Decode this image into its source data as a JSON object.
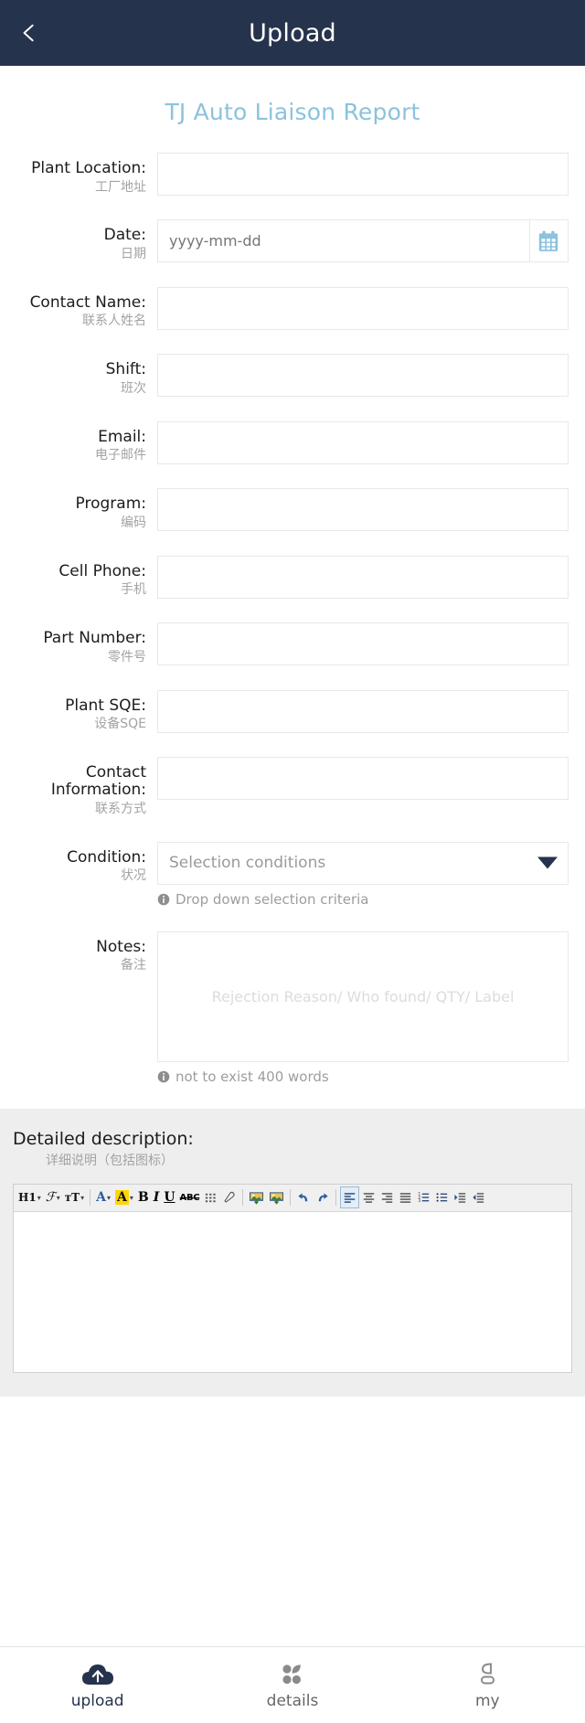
{
  "header": {
    "title": "Upload",
    "back_icon": "back-chevron-icon"
  },
  "report": {
    "title": "TJ Auto Liaison Report",
    "title_color": "#8cc2dd"
  },
  "form": {
    "fields": [
      {
        "label_en": "Plant Location:",
        "label_cn": "工厂地址",
        "type": "text",
        "value": "",
        "placeholder": ""
      },
      {
        "label_en": "Date:",
        "label_cn": "日期",
        "type": "date",
        "value": "",
        "placeholder": "yyyy-mm-dd",
        "icon": "calendar-icon"
      },
      {
        "label_en": "Contact Name:",
        "label_cn": "联系人姓名",
        "type": "text",
        "value": "",
        "placeholder": ""
      },
      {
        "label_en": "Shift:",
        "label_cn": "班次",
        "type": "text",
        "value": "",
        "placeholder": ""
      },
      {
        "label_en": "Email:",
        "label_cn": "电子邮件",
        "type": "text",
        "value": "",
        "placeholder": ""
      },
      {
        "label_en": "Program:",
        "label_cn": "编码",
        "type": "text",
        "value": "",
        "placeholder": ""
      },
      {
        "label_en": "Cell Phone:",
        "label_cn": "手机",
        "type": "text",
        "value": "",
        "placeholder": ""
      },
      {
        "label_en": "Part Number:",
        "label_cn": "零件号",
        "type": "text",
        "value": "",
        "placeholder": ""
      },
      {
        "label_en": "Plant SQE:",
        "label_cn": "设备SQE",
        "type": "text",
        "value": "",
        "placeholder": ""
      },
      {
        "label_en": "Contact Information:",
        "label_cn": "联系方式",
        "type": "text",
        "value": "",
        "placeholder": ""
      },
      {
        "label_en": "Condition:",
        "label_cn": "状况",
        "type": "select",
        "value": "",
        "placeholder": "Selection conditions",
        "hint": "Drop down selection criteria",
        "caret_color": "#26334d"
      },
      {
        "label_en": "Notes:",
        "label_cn": "备注",
        "type": "textarea",
        "value": "",
        "placeholder": "Rejection Reason/ Who found/ QTY/ Label",
        "hint": "not to exist 400 words"
      }
    ]
  },
  "description": {
    "heading_en": "Detailed description:",
    "heading_cn": "详细说明（包括图标）",
    "editor_value": "",
    "toolbar": [
      {
        "name": "heading-select",
        "label": "H1",
        "caret": true
      },
      {
        "name": "font-family-select",
        "label": "ℱ",
        "caret": true
      },
      {
        "name": "font-size-select",
        "label": "ᴛT",
        "caret": true
      },
      {
        "name": "separator-1",
        "label": ""
      },
      {
        "name": "text-color-button",
        "label": "A",
        "caret": true
      },
      {
        "name": "highlight-color-button",
        "label": "A",
        "caret": true
      },
      {
        "name": "bold-button",
        "label": "B"
      },
      {
        "name": "italic-button",
        "label": "I"
      },
      {
        "name": "underline-button",
        "label": "U"
      },
      {
        "name": "strikethrough-button",
        "label": "ABC"
      },
      {
        "name": "table-button",
        "label": ""
      },
      {
        "name": "clear-format-button",
        "label": ""
      },
      {
        "name": "separator-2",
        "label": ""
      },
      {
        "name": "insert-image-button",
        "label": ""
      },
      {
        "name": "upload-image-button",
        "label": ""
      },
      {
        "name": "separator-3",
        "label": ""
      },
      {
        "name": "undo-button",
        "label": ""
      },
      {
        "name": "redo-button",
        "label": ""
      },
      {
        "name": "separator-4",
        "label": ""
      },
      {
        "name": "align-left-button",
        "label": "",
        "active": true
      },
      {
        "name": "align-center-button",
        "label": ""
      },
      {
        "name": "align-right-button",
        "label": ""
      },
      {
        "name": "align-justify-button",
        "label": ""
      },
      {
        "name": "ordered-list-button",
        "label": ""
      },
      {
        "name": "unordered-list-button",
        "label": ""
      },
      {
        "name": "indent-button",
        "label": ""
      },
      {
        "name": "outdent-button",
        "label": ""
      }
    ]
  },
  "tabbar": {
    "items": [
      {
        "label": "upload",
        "icon": "cloud-upload-icon",
        "active": true
      },
      {
        "label": "details",
        "icon": "grid-icon",
        "active": false
      },
      {
        "label": "my",
        "icon": "person-icon",
        "active": false
      }
    ],
    "active_color": "#26334d",
    "inactive_color": "#8a8a8a"
  }
}
